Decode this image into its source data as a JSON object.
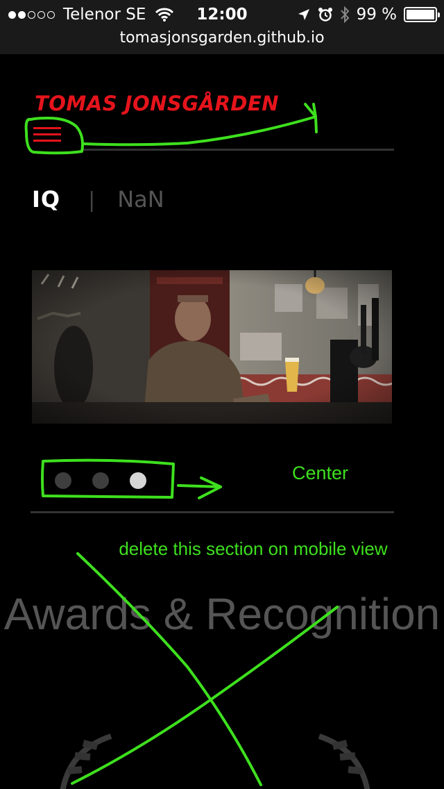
{
  "status_bar": {
    "carrier": "Telenor SE",
    "time": "12:00",
    "battery_percent": "99 %",
    "battery_level": 0.99,
    "signal_bars": 2,
    "signal_total": 5
  },
  "url_bar": {
    "url": "tomasjonsgarden.github.io"
  },
  "site": {
    "brand": "TOMAS JONSGÅRDEN",
    "tabs": {
      "active": "IQ",
      "separator": "|",
      "other": "NaN"
    },
    "slider": {
      "dot_count": 3,
      "active_index": 2
    },
    "awards_title": "Awards & Recognition"
  },
  "annotations": {
    "center_label": "Center",
    "delete_note": "delete this section on mobile view",
    "color": "#3ee01e"
  },
  "colors": {
    "brand_red": "#e5141c",
    "background": "#000000"
  }
}
